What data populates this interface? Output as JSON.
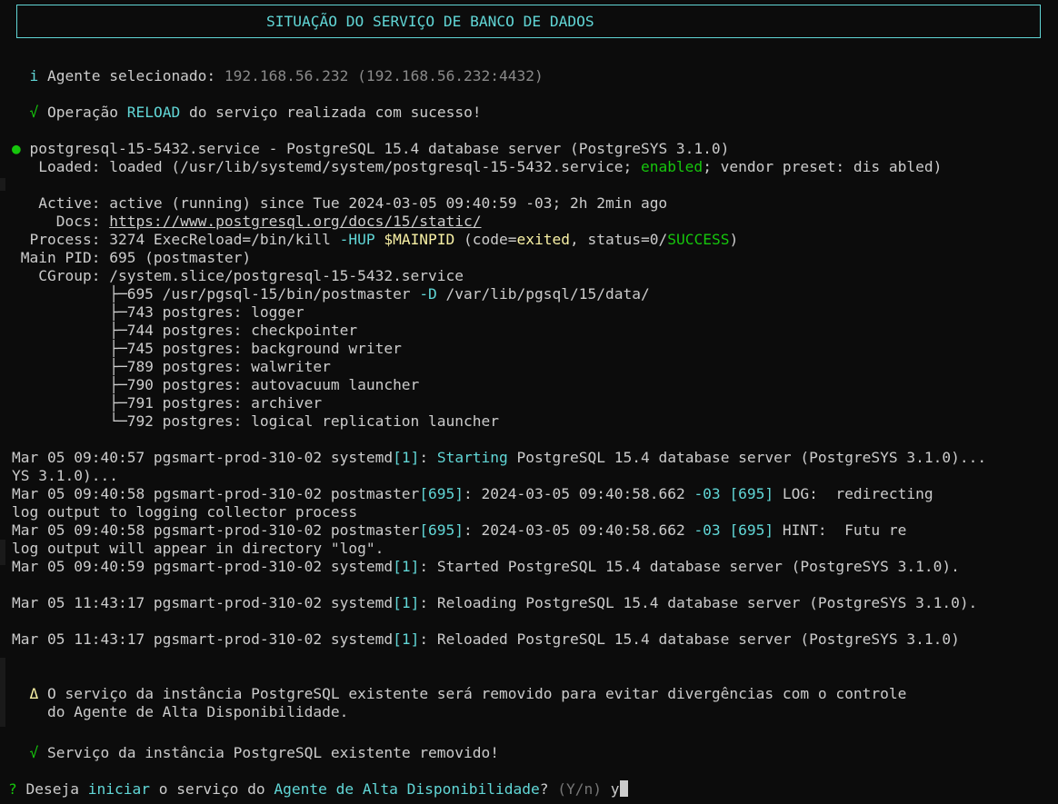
{
  "banner": {
    "title": "SITUAÇÃO DO SERVIÇO DE BANCO DE DADOS"
  },
  "colors": {
    "background": "#0c0c0c",
    "foreground": "#cccccc",
    "cyan": "#61d6d6",
    "green": "#16c60c",
    "yellow": "#f9f1a5",
    "gray": "#8a8a8a"
  },
  "info": {
    "icon": "i",
    "label": "Agente selecionado: ",
    "agent": "192.168.56.232 (192.168.56.232:4432)"
  },
  "reload": {
    "icon": "√",
    "pre": "Operação ",
    "op": "RELOAD",
    "post": " do serviço realizada com sucesso!"
  },
  "status": {
    "bullet": "●",
    "header": " postgresql-15-5432.service - PostgreSQL 15.4 database server (PostgreSYS 3.1.0)",
    "loaded_pre": "   Loaded: loaded (/usr/lib/systemd/system/postgresql-15-5432.service; ",
    "loaded_enabled": "enabled",
    "loaded_post": "; vendor preset: dis abled)",
    "active": "   Active: active (running) since Tue 2024-03-05 09:40:59 -03; 2h 2min ago",
    "docs_label": "     Docs: ",
    "docs_url": "https://www.postgresql.org/docs/15/static/",
    "process_pre": "  Process: 3274 ExecReload=/bin/kill ",
    "process_hup": "-HUP",
    "process_sp": " ",
    "process_var": "$MAINPID",
    "process_mid": " (code=",
    "process_exited": "exited",
    "process_mid2": ", status=0/",
    "process_success": "SUCCESS",
    "process_end": ")",
    "mainpid": " Main PID: 695 (postmaster)",
    "cgroup": "   CGroup: /system.slice/postgresql-15-5432.service",
    "tree0_pre": "           ├─695 /usr/pgsql-15/bin/postmaster ",
    "tree0_flag": "-D",
    "tree0_post": " /var/lib/pgsql/15/data/",
    "tree": [
      "           ├─743 postgres: logger",
      "           ├─744 postgres: checkpointer",
      "           ├─745 postgres: background writer",
      "           ├─789 postgres: walwriter",
      "           ├─790 postgres: autovacuum launcher",
      "           ├─791 postgres: archiver",
      "           └─792 postgres: logical replication launcher"
    ]
  },
  "logs": {
    "l1_pre": "Mar 05 09:40:57 pgsmart-prod-310-02 systemd",
    "l1_pid": "[1]",
    "l1_colon": ": ",
    "l1_start": "Starting",
    "l1_post": " PostgreSQL 15.4 database server (PostgreSYS 3.1.0)...",
    "l1_wrap": "YS 3.1.0)...",
    "l2_pre": "Mar 05 09:40:58 pgsmart-prod-310-02 postmaster",
    "l2_pid": "[695]",
    "l2_mid": ": 2024-03-05 09:40:58.662 ",
    "l2_tz": "-03",
    "l2_sp": " ",
    "l2_pid2": "[695]",
    "l2_post": " LOG:  redirecting",
    "l2_wrap": "log output to logging collector process",
    "l3_pre": "Mar 05 09:40:58 pgsmart-prod-310-02 postmaster",
    "l3_pid": "[695]",
    "l3_mid": ": 2024-03-05 09:40:58.662 ",
    "l3_tz": "-03",
    "l3_sp": " ",
    "l3_pid2": "[695]",
    "l3_post": " HINT:  Futu re",
    "l3_wrap": "log output will appear in directory \"log\".",
    "l4_pre": "Mar 05 09:40:59 pgsmart-prod-310-02 systemd",
    "l4_pid": "[1]",
    "l4_post": ": Started PostgreSQL 15.4 database server (PostgreSYS 3.1.0).",
    "l5_pre": "Mar 05 11:43:17 pgsmart-prod-310-02 systemd",
    "l5_pid": "[1]",
    "l5_post": ": Reloading PostgreSQL 15.4 database server (PostgreSYS 3.1.0).",
    "l6_pre": "Mar 05 11:43:17 pgsmart-prod-310-02 systemd",
    "l6_pid": "[1]",
    "l6_post": ": Reloaded PostgreSQL 15.4 database server (PostgreSYS 3.1.0)"
  },
  "warning": {
    "icon": "Δ",
    "line1": " O serviço da instância PostgreSQL existente será removido para evitar divergências com o controle",
    "line2": "  do Agente de Alta Disponibilidade."
  },
  "removed": {
    "icon": "√",
    "text": " Serviço da instância PostgreSQL existente removido!"
  },
  "prompt": {
    "mark": "?",
    "pre": " Deseja ",
    "action": "iniciar",
    "mid": " o serviço do ",
    "agent": "Agente de Alta Disponibilidade",
    "q": "? ",
    "hint": "(Y/n)",
    "sp": " ",
    "answer": "y"
  }
}
